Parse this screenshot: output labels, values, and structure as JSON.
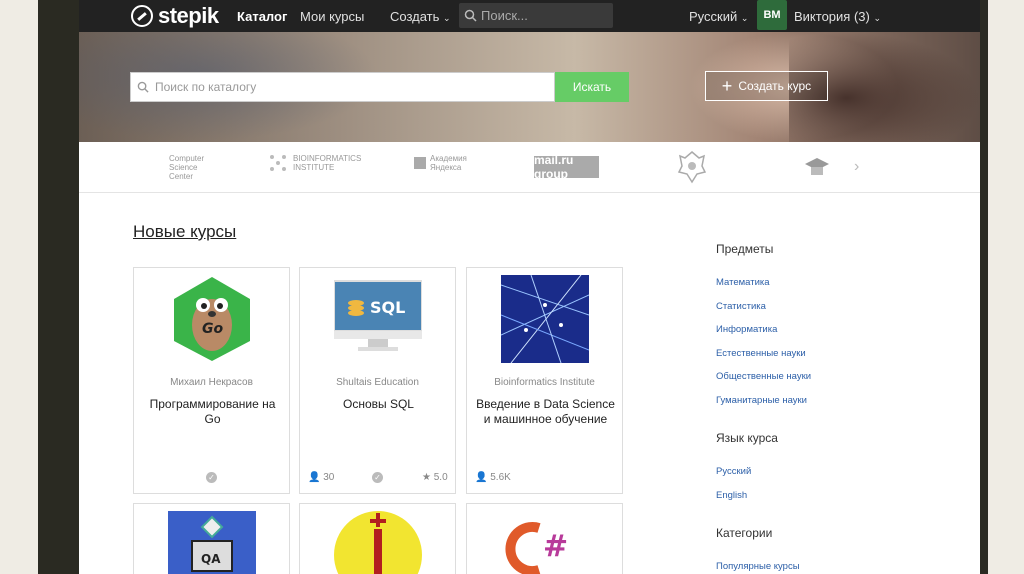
{
  "nav": {
    "logo": "stepik",
    "catalog": "Каталог",
    "my_courses": "Мои курсы",
    "create": "Создать",
    "search_placeholder": "Поиск...",
    "language": "Русский",
    "avatar_initials": "ВМ",
    "user": "Виктория (3)"
  },
  "hero": {
    "search_placeholder": "Поиск по каталогу",
    "search_button": "Искать",
    "create_course": "Создать курс"
  },
  "partners": [
    "Computer Science Center",
    "BIOINFORMATICS INSTITUTE",
    "Академия Яндекса",
    "mail.ru group"
  ],
  "main": {
    "section_title": "Новые курсы",
    "courses": [
      {
        "author": "Михаил Некрасов",
        "title": "Программирование на Go",
        "learners": "",
        "rating": ""
      },
      {
        "author": "Shultais Education",
        "title": "Основы SQL",
        "learners": "30",
        "rating": "5.0"
      },
      {
        "author": "Bioinformatics Institute",
        "title": "Введение в Data Science и машинное обучение",
        "learners": "5.6K",
        "rating": ""
      }
    ],
    "bottom_card_labels": [
      "QA"
    ]
  },
  "sidebar": {
    "subjects_title": "Предметы",
    "subjects": [
      "Математика",
      "Статистика",
      "Информатика",
      "Естественные науки",
      "Общественные науки",
      "Гуманитарные науки"
    ],
    "language_title": "Язык курса",
    "languages": [
      "Русский",
      "English"
    ],
    "categories_title": "Категории",
    "categories": [
      "Популярные курсы"
    ]
  },
  "colors": {
    "nav_bg": "#222222",
    "accent_green": "#66cc66",
    "link_blue": "#2c5fa8"
  }
}
